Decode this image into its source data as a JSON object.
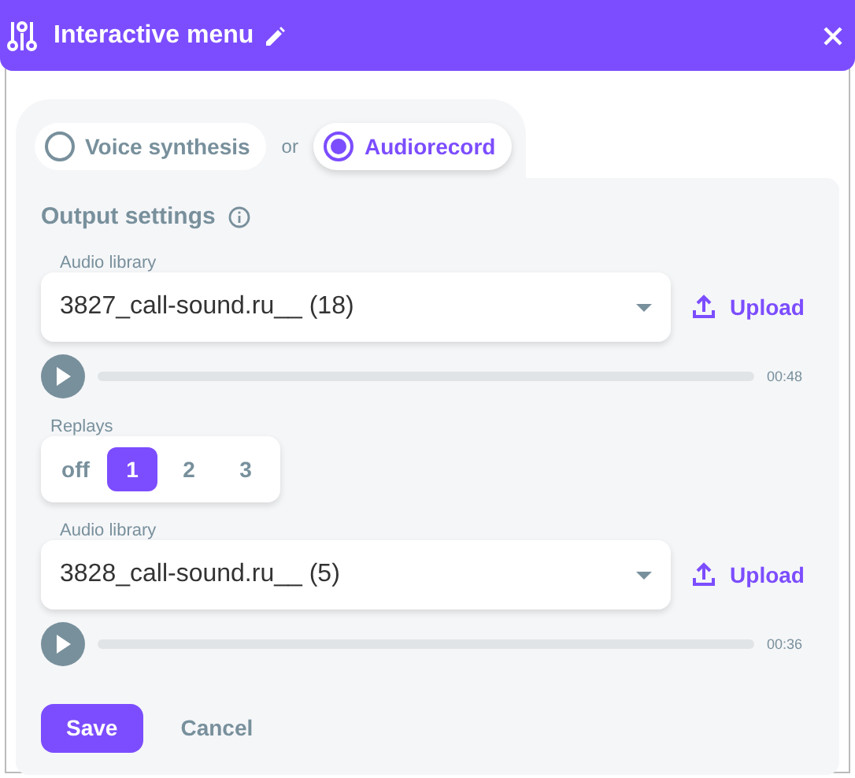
{
  "window": {
    "title": "Interactive menu"
  },
  "modes": [
    {
      "label": "Voice synthesis",
      "selected": false
    },
    {
      "label": "Audiorecord",
      "selected": true
    }
  ],
  "modes_separator": "or",
  "section": {
    "title": "Output settings"
  },
  "blocks": [
    {
      "kind": "audio",
      "label": "Audio library",
      "value": "3827_call-sound.ru__ (18)",
      "upload": "Upload",
      "level": 0,
      "time": "00:48"
    },
    {
      "kind": "replays",
      "label": "Replays",
      "options": [
        {
          "label": "off",
          "selected": false
        },
        {
          "label": "1",
          "selected": true
        },
        {
          "label": "2",
          "selected": false
        },
        {
          "label": "3",
          "selected": false
        }
      ]
    },
    {
      "kind": "audio",
      "label": "Audio library",
      "value": "3828_call-sound.ru__ (5)",
      "upload": "Upload",
      "level": 0,
      "time": "00:36"
    }
  ],
  "buttons": {
    "save": "Save",
    "cancel": "Cancel"
  }
}
